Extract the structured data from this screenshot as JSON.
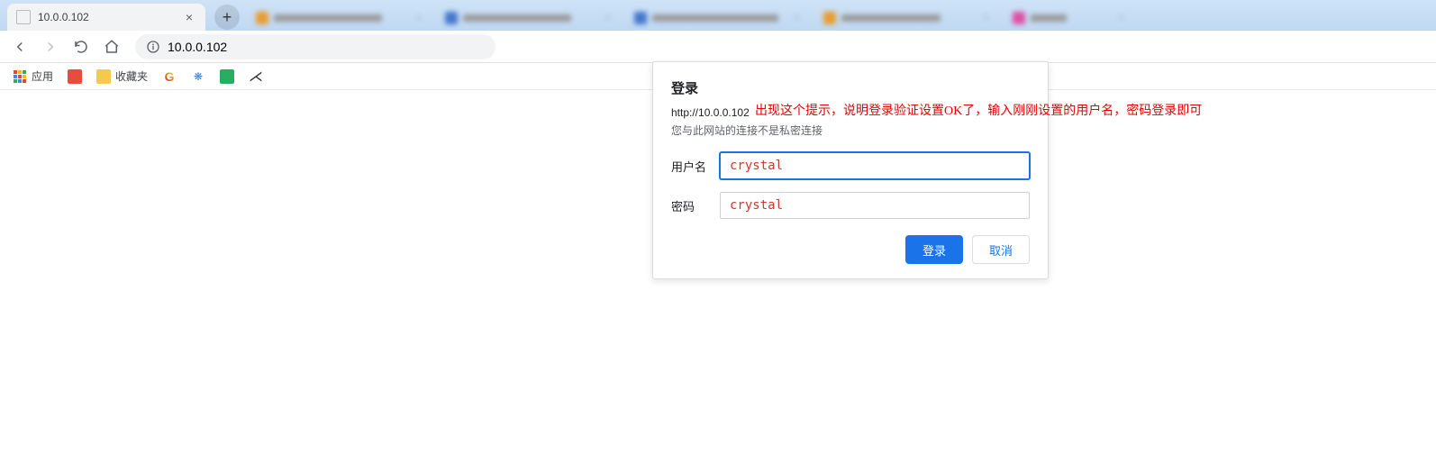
{
  "tab": {
    "title": "10.0.0.102"
  },
  "address": {
    "url": "10.0.0.102"
  },
  "bookmarks": {
    "apps": "应用",
    "favorites": "收藏夹"
  },
  "dialog": {
    "title": "登录",
    "url": "http://10.0.0.102",
    "insecure_note": "您与此网站的连接不是私密连接",
    "username_label": "用户名",
    "username_value": "crystal",
    "password_label": "密码",
    "password_value": "crystal",
    "login_btn": "登录",
    "cancel_btn": "取消"
  },
  "annotation": {
    "text": "出现这个提示，说明登录验证设置OK了，输入刚刚设置的用户名，密码登录即可"
  }
}
